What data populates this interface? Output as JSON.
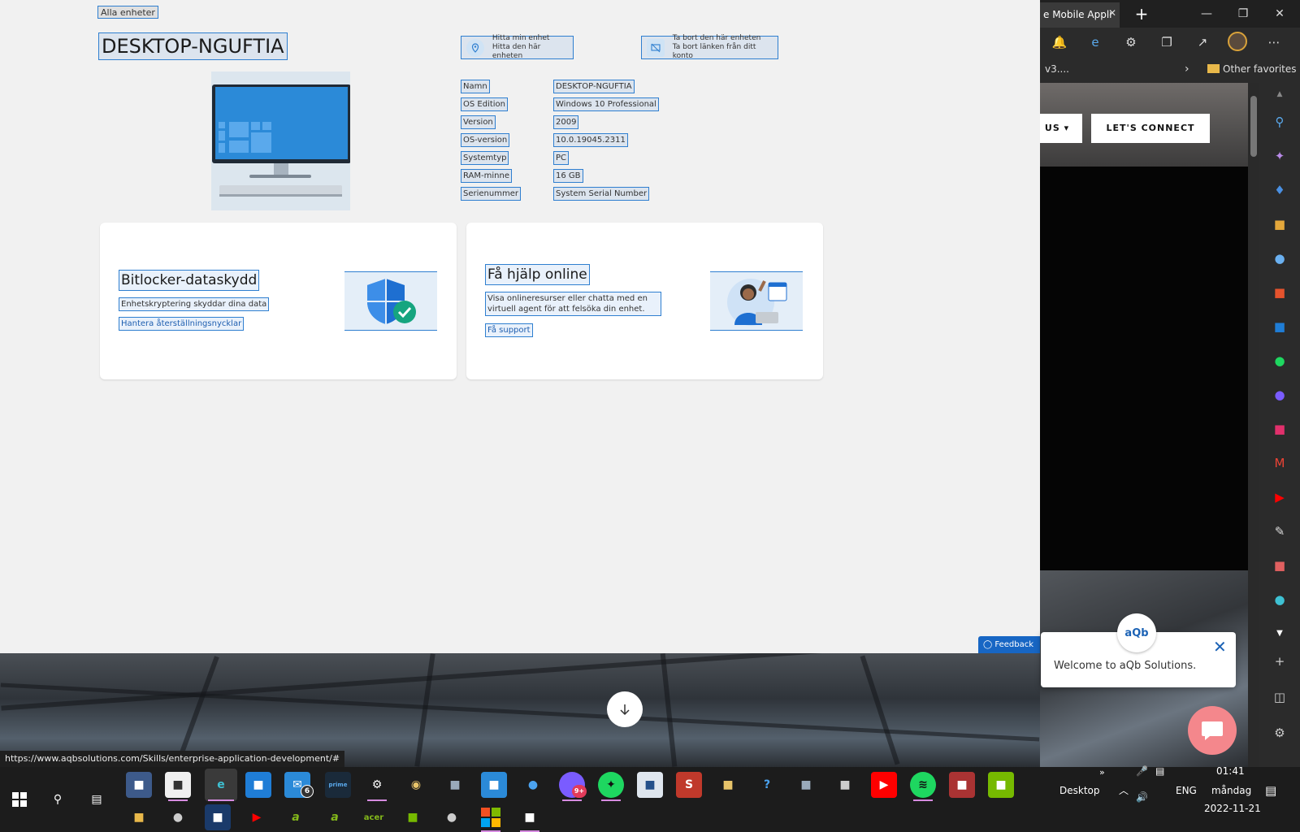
{
  "device": {
    "breadcrumb": "Alla enheter",
    "title": "DESKTOP-NGUFTIA",
    "actions": [
      {
        "title": "Hitta min enhet",
        "subtitle": "Hitta den här enheten",
        "icon": "location-pin-icon"
      },
      {
        "title": "Ta bort den här enheten",
        "subtitle": "Ta bort länken från ditt konto",
        "icon": "unlink-device-icon"
      }
    ],
    "info": [
      {
        "label": "Namn",
        "value": "DESKTOP-NGUFTIA"
      },
      {
        "label": "OS Edition",
        "value": "Windows 10 Professional"
      },
      {
        "label": "Version",
        "value": "2009"
      },
      {
        "label": "OS-version",
        "value": "10.0.19045.2311"
      },
      {
        "label": "Systemtyp",
        "value": "PC"
      },
      {
        "label": "RAM-minne",
        "value": "16 GB"
      },
      {
        "label": "Serienummer",
        "value": "System Serial Number"
      }
    ],
    "cards": {
      "bitlocker": {
        "title": "Bitlocker-dataskydd",
        "text": "Enhetskryptering skyddar dina data",
        "link": "Hantera återställningsnycklar"
      },
      "help": {
        "title": "Få hjälp online",
        "text": "Visa onlineresurser eller chatta med en virtuell agent för att felsöka din enhet.",
        "link": "Få support"
      }
    },
    "feedback_label": "Feedback"
  },
  "status_url": "https://www.aqbsolutions.com/Skills/enterprise-application-development/#",
  "browser": {
    "tab_title": "e Mobile Appli",
    "favorites_truncated": "v3....",
    "other_favorites": "Other favorites",
    "site_nav_partial": "US",
    "site_nav_cta": "LET'S CONNECT",
    "chat_logo": "aQb",
    "chat_welcome": "Welcome to aQb Solutions.",
    "colors": {
      "accent": "#1766c4",
      "chat_fab": "#f4878c",
      "highlight": "#2f7fd0"
    }
  },
  "taskbar": {
    "mail_badge": "6",
    "messenger_badge": "9+",
    "desktop_label": "Desktop",
    "language": "ENG",
    "time": "01:41",
    "day": "måndag",
    "date": "2022-11-21"
  }
}
